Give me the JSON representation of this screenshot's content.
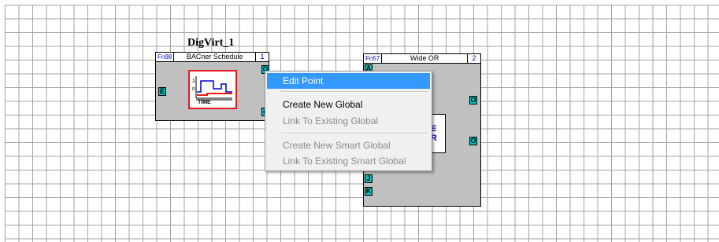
{
  "blocks": [
    {
      "title": "DigVirt_1",
      "fn": "Fn98",
      "name": "BACner Schedule",
      "number": "1",
      "ports": [
        "E",
        "O",
        "o"
      ],
      "icon_label": "TIME",
      "icon_levels": [
        "1",
        "n"
      ]
    },
    {
      "fn": "Fn57",
      "name": "Wide OR",
      "number": "2",
      "ports": [
        "A",
        "O",
        "O",
        "J",
        "K"
      ],
      "icon_text": [
        "E",
        "R"
      ]
    }
  ],
  "context_menu": {
    "items": [
      {
        "label": "Edit Point",
        "state": "highlighted"
      },
      {
        "label": "Create New Global",
        "state": "enabled"
      },
      {
        "label": "Link To Existing Global",
        "state": "disabled"
      },
      {
        "label": "Create New Smart Global",
        "state": "disabled"
      },
      {
        "label": "Link To Existing Smart Global",
        "state": "disabled"
      }
    ]
  },
  "colors": {
    "grid": "#a3a3a3",
    "block_fill": "#c0c0c0",
    "port_fill": "#00c0c0",
    "menu_highlight": "#3399ff",
    "schedule_icon_border": "#e8191b"
  }
}
